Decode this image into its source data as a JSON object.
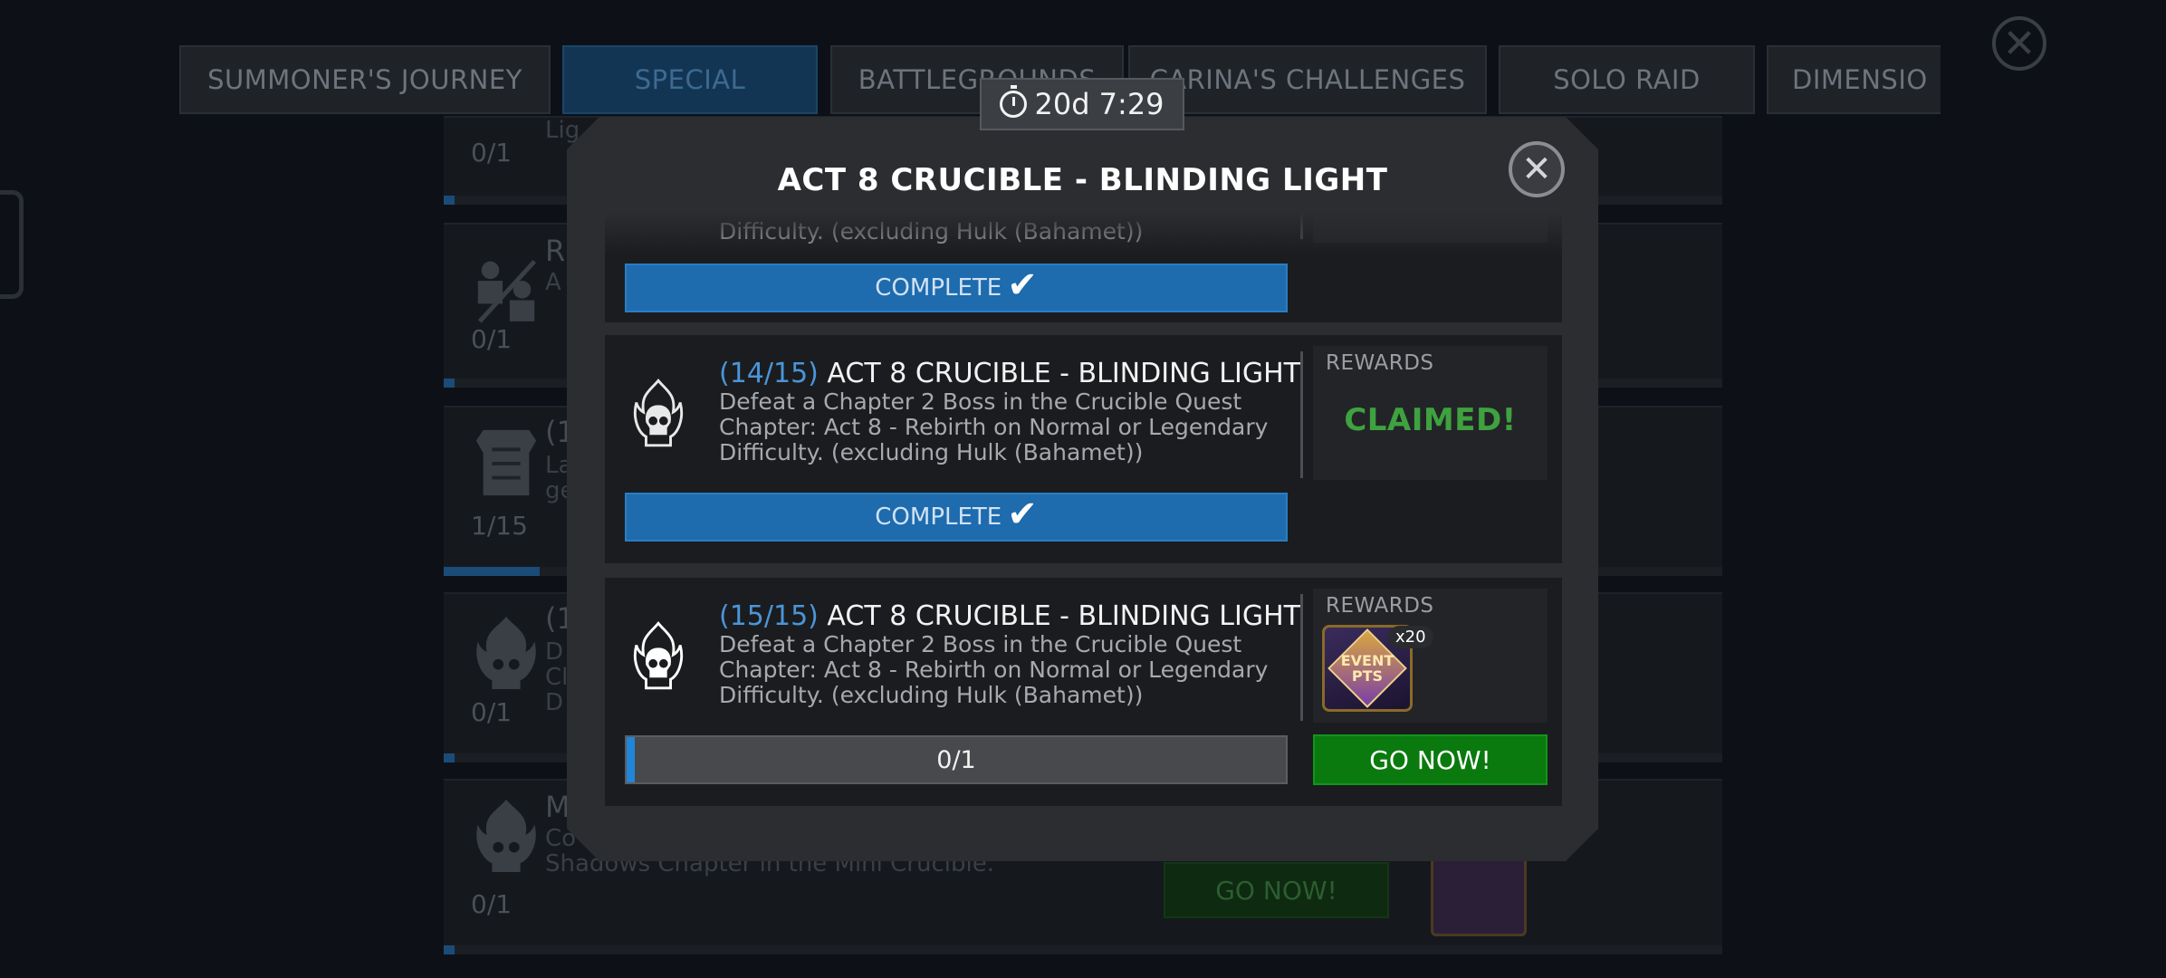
{
  "tabs": [
    {
      "label": "SUMMONER'S JOURNEY",
      "active": false
    },
    {
      "label": "SPECIAL",
      "active": true
    },
    {
      "label": "BATTLEGROUNDS",
      "active": false
    },
    {
      "label": "CARINA'S CHALLENGES",
      "active": false
    },
    {
      "label": "SOLO RAID",
      "active": false
    },
    {
      "label": "DIMENSIO",
      "active": false
    }
  ],
  "background": {
    "cards": [
      {
        "count": "0/1",
        "title": "",
        "desc": "Lig"
      },
      {
        "count": "0/1",
        "title": "R",
        "desc": "A"
      },
      {
        "count": "1/15",
        "title": "(1",
        "desc": "La\nge"
      },
      {
        "count": "0/1",
        "title": "(1",
        "desc": "D\nCl\nD"
      },
      {
        "count": "0/1",
        "title": "M",
        "desc": "Co\nShadows Chapter in the Mini Crucible."
      }
    ],
    "go_label": "GO NOW!"
  },
  "modal": {
    "title": "ACT 8 CRUCIBLE - BLINDING LIGHT",
    "timer": "20d 7:29",
    "quests": [
      {
        "index": "",
        "title": "",
        "desc": "Difficulty. (excluding Hulk (Bahamet))",
        "status": "complete",
        "complete_label": "COMPLETE"
      },
      {
        "index": "(14/15)",
        "title": "ACT 8 CRUCIBLE - BLINDING LIGHT",
        "desc": "Defeat a Chapter 2 Boss in the Crucible Quest Chapter: Act 8 - Rebirth on Normal or Legendary Difficulty. (excluding Hulk (Bahamet))",
        "status": "complete",
        "complete_label": "COMPLETE",
        "rewards_label": "REWARDS",
        "claimed_label": "CLAIMED!"
      },
      {
        "index": "(15/15)",
        "title": "ACT 8 CRUCIBLE - BLINDING LIGHT",
        "desc": "Defeat a Chapter 2 Boss in the Crucible Quest Chapter: Act 8 - Rebirth on Normal or Legendary Difficulty. (excluding Hulk (Bahamet))",
        "status": "in_progress",
        "progress_text": "0/1",
        "progress_fraction": 0.01,
        "rewards_label": "REWARDS",
        "reward": {
          "name": "EVENT PTS",
          "multiplier": "x20"
        },
        "go_label": "GO NOW!"
      }
    ]
  },
  "icons": [
    "flaming-skull-icon",
    "close-icon",
    "stopwatch-icon",
    "checkmark-icon",
    "event-pts-icon"
  ],
  "colors": {
    "accent_blue": "#1e6bae",
    "index_blue": "#4a95d8",
    "claimed_green": "#3ea23f",
    "go_green": "#0a7a0e"
  }
}
